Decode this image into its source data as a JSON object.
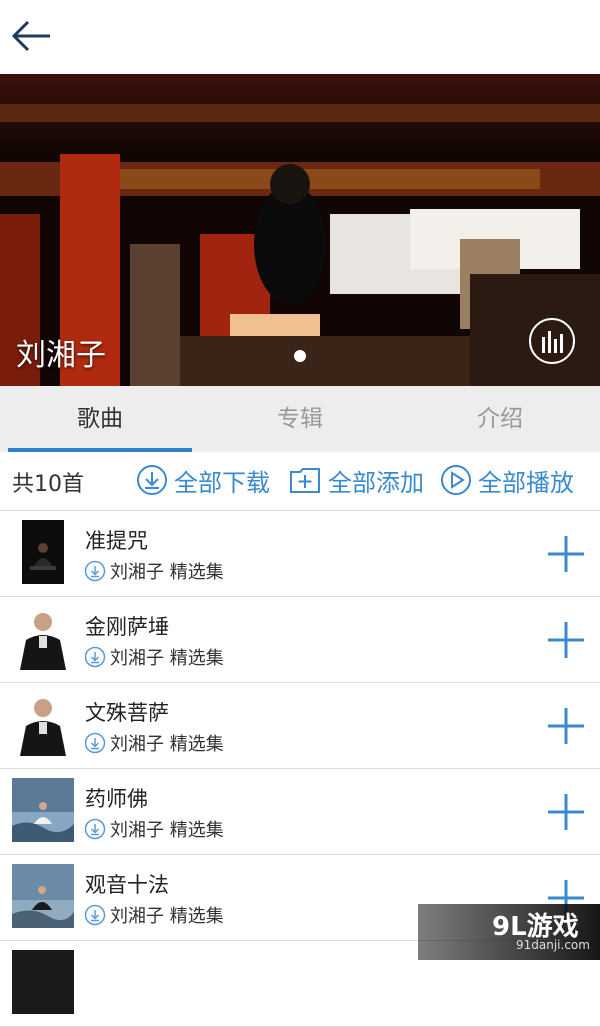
{
  "header": {
    "back_icon": "arrow-left-icon"
  },
  "hero": {
    "artist_name": "刘湘子",
    "equalizer_icon": "equalizer-icon"
  },
  "tabs": [
    {
      "label": "歌曲",
      "active": true
    },
    {
      "label": "专辑",
      "active": false
    },
    {
      "label": "介绍",
      "active": false
    }
  ],
  "actions": {
    "count": "共10首",
    "download_all": "全部下载",
    "add_all": "全部添加",
    "play_all": "全部播放"
  },
  "songs": [
    {
      "title": "准提咒",
      "subtitle": "刘湘子 精选集"
    },
    {
      "title": "金刚萨埵",
      "subtitle": "刘湘子 精选集"
    },
    {
      "title": "文殊菩萨",
      "subtitle": "刘湘子 精选集"
    },
    {
      "title": "药师佛",
      "subtitle": "刘湘子 精选集"
    },
    {
      "title": "观音十法",
      "subtitle": "刘湘子 精选集"
    }
  ],
  "watermark": {
    "logo": "9L游戏",
    "site": "91danji.com"
  },
  "colors": {
    "accent": "#2f80c8",
    "tab_bg": "#ededed"
  }
}
